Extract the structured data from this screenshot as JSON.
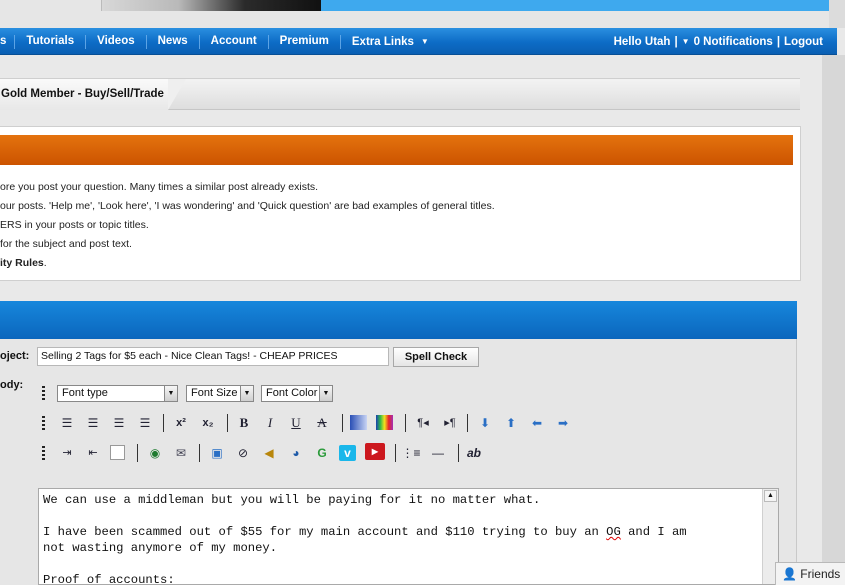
{
  "nav": {
    "items": [
      "s",
      "Tutorials",
      "Videos",
      "News",
      "Account",
      "Premium",
      "Extra Links"
    ],
    "greeting": "Hello Utah",
    "notifications": "0 Notifications",
    "logout": "Logout",
    "separator": "|"
  },
  "breadcrumb": {
    "current": "Gold Member - Buy/Sell/Trade"
  },
  "rules": {
    "lines": [
      "ore you post your question. Many times a similar post already exists.",
      "our posts. 'Help me', 'Look here', 'I was wondering' and 'Quick question' are bad examples of general titles.",
      "ERS in your posts or topic titles.",
      "for the subject and post text.",
      "ity Rules"
    ],
    "last_suffix": "."
  },
  "form": {
    "subject_label": "oject:",
    "body_label": "ody:",
    "subject_value": "Selling 2 Tags for $5 each - Nice Clean Tags! - CHEAP PRICES",
    "spell_check": "Spell Check",
    "font_type": "Font type",
    "font_size": "Font Size",
    "font_color": "Font Color"
  },
  "editor": {
    "line1": "We can use a middleman but you will be paying for it no matter what.",
    "line2a": "I have been scammed out of $55 for my main account and $110 trying to buy an ",
    "line2b": "OG",
    "line2c": " and I am",
    "line3": "not wasting anymore of my money.",
    "line4": "Proof of accounts:"
  },
  "friends": {
    "label": "Friends"
  },
  "colors": {
    "nav_blue": "#0d6cc6",
    "header_orange": "#d85f05",
    "panel_blue": "#0b66bd"
  }
}
